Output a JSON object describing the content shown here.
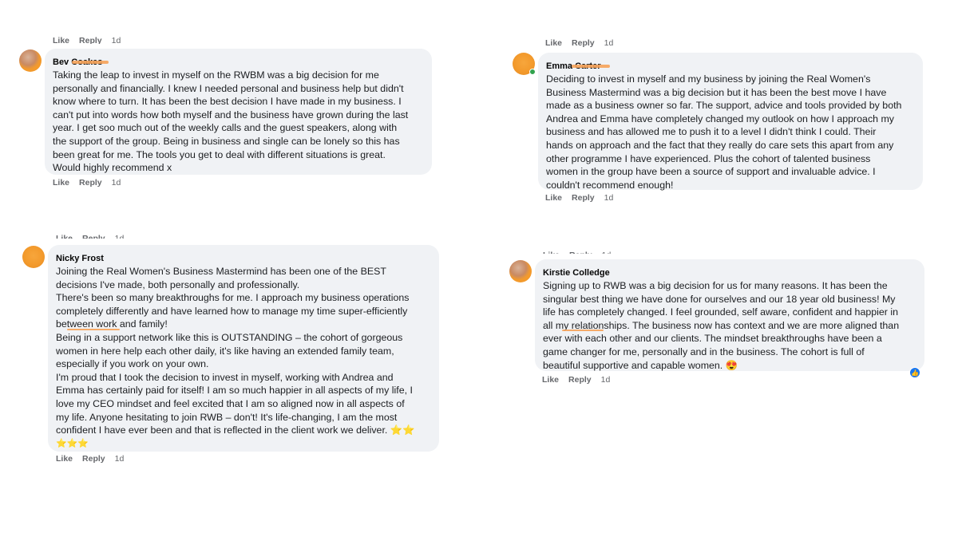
{
  "action_labels": {
    "like": "Like",
    "reply": "Reply",
    "time": "1d"
  },
  "colors": {
    "bubble": "#f0f2f5",
    "avatar": "#f39a2c",
    "redaction": "#f6a35a",
    "meta": "#65676b",
    "like_badge": "#1877f2"
  },
  "icons": {
    "like_reaction": "thumbs-up-icon",
    "online": "online-dot-icon"
  },
  "comments": [
    {
      "author": "Bev",
      "author_redacted": "Coakes",
      "lines": [
        "Taking the leap to invest in myself on the RWBM was a big decision for me",
        "personally and financially. I knew I needed personal and business help but didn't",
        "know where to turn. It has been the best decision I have made in my business. I",
        "can't put into words how both myself and the business have grown during the last",
        "year. I get soo much out of the weekly calls and the guest speakers, along with",
        "the support of the group. Being in business and single can be lonely so this has",
        "been great for me. The tools you get to deal with different situations is great.",
        "Would highly recommend x"
      ]
    },
    {
      "author": "Emma",
      "author_redacted": "Carter",
      "lines": [
        "Deciding to invest in myself and my business by joining the Real Women's",
        "Business Mastermind was a big decision but it has been the best move I have",
        "made as a business owner so far. The support, advice and tools provided by both",
        "Andrea and Emma have completely changed my outlook on how I approach my",
        "business and has allowed me to push it to a level I didn't think I could. Their",
        "hands on approach and the fact that they really do care sets this apart from any",
        "other programme I have experienced. Plus the cohort of talented business",
        "women in the group have been a source of support and invaluable advice. I",
        "couldn't recommend enough!"
      ]
    },
    {
      "author": "Nicky Frost",
      "lines": [
        "Joining the Real Women's Business Mastermind has been one of the BEST",
        "decisions I've made, both personally and professionally.",
        "There's been so many breakthroughs for me. I approach my business operations",
        "completely differently and have learned how to manage my time super-efficiently",
        "between work and family!",
        "Being in a support network like this is OUTSTANDING – the cohort of gorgeous",
        "women in here help each other daily, it's like having an extended family team,",
        "especially if you work on your own.",
        "I'm proud that I took the decision to invest in myself, working with Andrea and",
        "Emma has certainly paid for itself! I am so much happier in all aspects of my life, I",
        "love my CEO mindset and feel excited that I am so aligned now in all aspects of",
        "my life. Anyone hesitating to join RWB – don't! It's life-changing, I am the most",
        "confident I have ever been and that is reflected in the client work we deliver. ⭐⭐",
        "⭐⭐⭐"
      ]
    },
    {
      "author": "Kirstie Colledge",
      "lines": [
        "Signing up to RWB was a big decision for us for many reasons. It has been the",
        "singular best thing we have done for ourselves and our 18 year old business! My",
        "life has completely changed. I feel grounded, self aware, confident and happier in",
        "all my relationships. The business now has context and we are more aligned than",
        "ever with each other and our clients. The mindset breakthroughs have been a",
        "game changer for me, personally and in the business. The cohort is full of",
        "beautiful supportive and capable women. 😍"
      ]
    }
  ]
}
